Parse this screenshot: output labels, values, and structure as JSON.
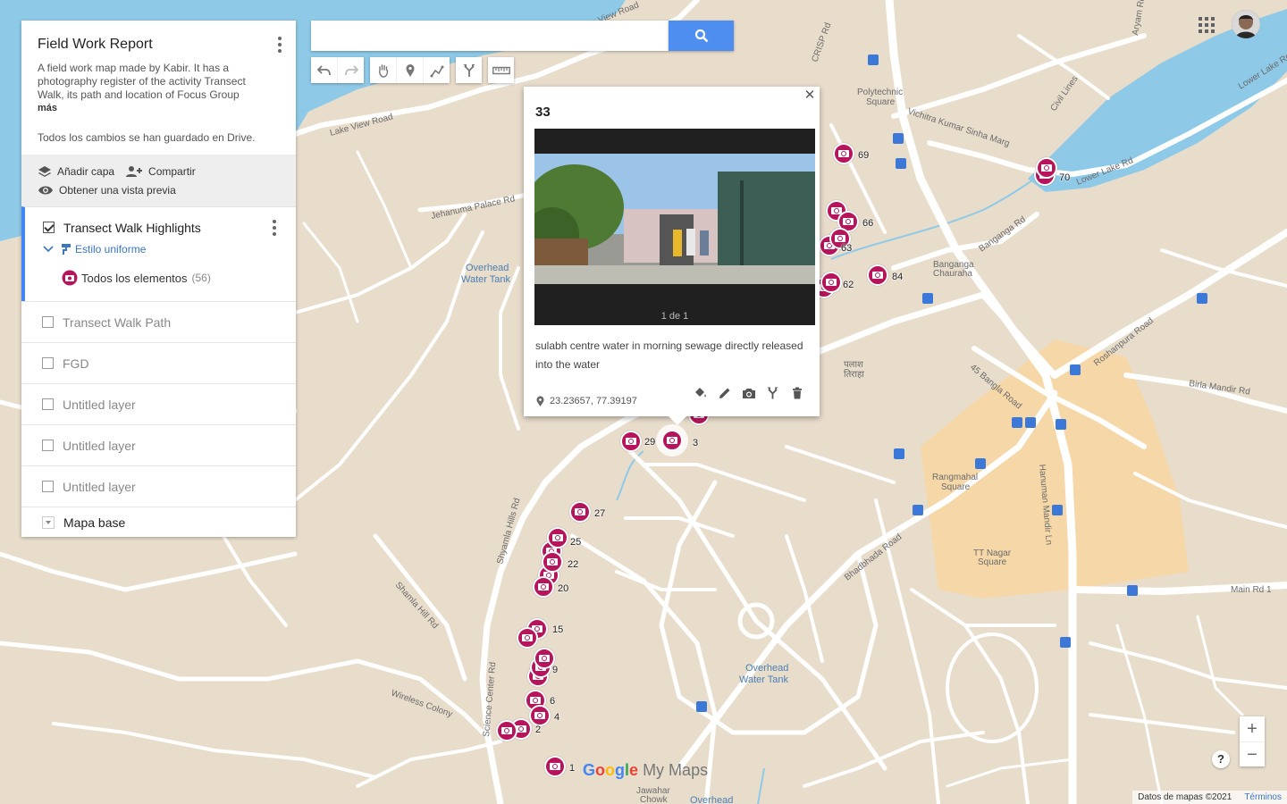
{
  "map": {
    "labels": {
      "lake_view": "Lake View Road",
      "jehanuma": "Jehanuma Palace Rd",
      "overhead1_a": "Overhead",
      "overhead1_b": "Water Tank",
      "overhead2_a": "Overhead",
      "overhead2_b": "Water Tank",
      "overhead3": "Overhead",
      "polytechnic_a": "Polytechnic",
      "polytechnic_b": "Square",
      "vichitra": "Vichitra Kumar Sinha Marg",
      "banganga_a": "Banganga",
      "banganga_b": "Chauraha",
      "banganga_rd": "Banganga Rd",
      "lower_lake": "Lower Lake Rd",
      "roshanpura": "Roshanpura Road",
      "bangla": "45 Bangla Road",
      "birla": "Birla Mandir Rd",
      "rangmahal_a": "Rangmahal",
      "rangmahal_b": "Square",
      "tt_a": "TT Nagar",
      "tt_b": "Square",
      "bhadbhada": "Bhadbhada Road",
      "hanuman": "Hanuman Mandir Ln",
      "main_rd": "Main Rd 1",
      "shyamla": "Shyamla Hills Rd",
      "shamla": "Shamla Hill Rd",
      "science": "Science Center Rd",
      "wireless": "Wireless Colony",
      "jawahar_a": "Jawahar",
      "jawahar_b": "Chowk",
      "palash_a": "पलाश",
      "palash_b": "तिराहा",
      "lake_view_top": "Lake View Road",
      "crisp": "CRISP Rd",
      "civil": "Civil Lines",
      "aryam": "Aryam Rd",
      "lower_lake2": "Lower Lake Rd"
    }
  },
  "panel": {
    "title": "Field Work Report",
    "description": "A field work map made by Kabir. It has a photography register of the activity Transect Walk, its path and location of Focus Group",
    "more": "más",
    "saved": "Todos los cambios se han guardado en Drive.",
    "actions": {
      "add_layer": "Añadir capa",
      "share": "Compartir",
      "preview": "Obtener una vista previa"
    },
    "active_layer": {
      "name": "Transect Walk Highlights",
      "style": "Estilo uniforme",
      "items_label": "Todos los elementos",
      "items_count": "(56)"
    },
    "layers": [
      "Transect Walk Path",
      "FGD",
      "Untitled layer",
      "Untitled layer",
      "Untitled layer"
    ],
    "base_map": "Mapa base"
  },
  "search": {
    "value": ""
  },
  "popup": {
    "title": "33",
    "counter": "1 de 1",
    "description": "sulabh centre water in morning sewage directly released into the water",
    "coords": "23.23657, 77.39197"
  },
  "markers": [
    "69",
    "70",
    "66",
    "63",
    "84",
    "62",
    "29",
    "3",
    "27",
    "25",
    "22",
    "20",
    "15",
    "9",
    "6",
    "4",
    "2",
    "1"
  ],
  "footer": {
    "attribution": "Datos de mapas ©2021",
    "terms": "Términos"
  },
  "logo": {
    "google": "Google",
    "mymaps": "My Maps"
  },
  "colors": {
    "marker": "#b7155b",
    "accent": "#4285f4",
    "land": "#e8dccb",
    "water": "#8ecae8",
    "road": "#ffffff",
    "urban": "#f6d7a8"
  }
}
